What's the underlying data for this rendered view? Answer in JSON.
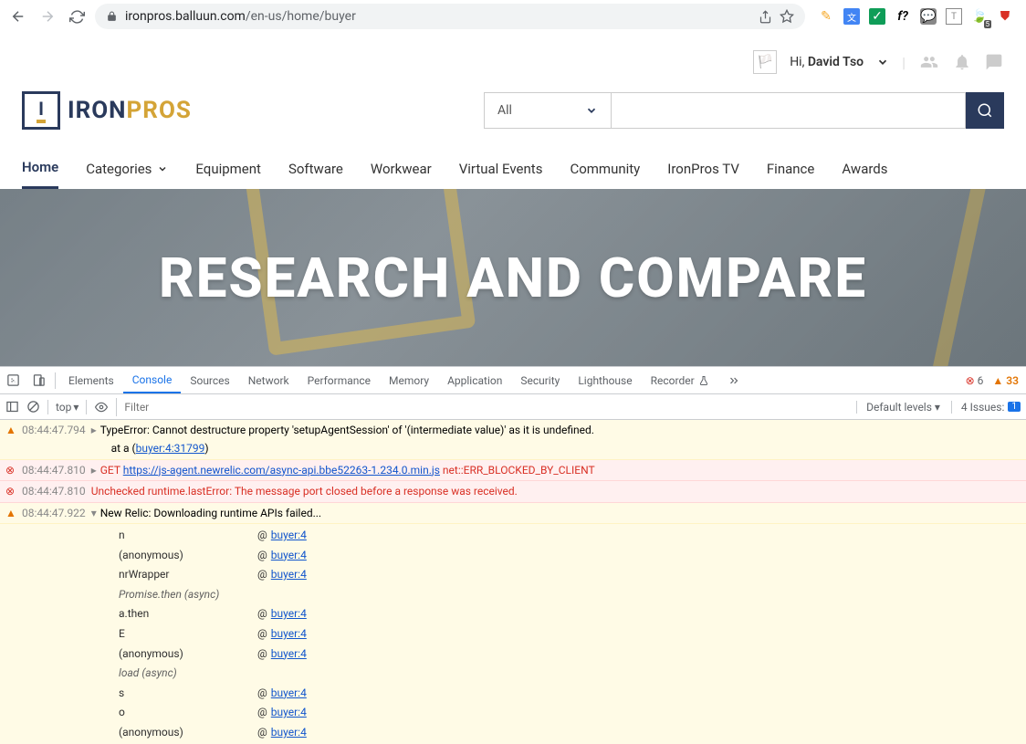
{
  "browser": {
    "url_domain": "ironpros.balluun.com",
    "url_path": "/en-us/home/buyer"
  },
  "header": {
    "greeting_prefix": "Hi, ",
    "greeting_name": "David Tso",
    "logo_iron": "IRON",
    "logo_pros": "PROS",
    "logo_mark": "I",
    "search_category": "All",
    "nav": {
      "home": "Home",
      "categories": "Categories",
      "equipment": "Equipment",
      "software": "Software",
      "workwear": "Workwear",
      "virtual": "Virtual Events",
      "community": "Community",
      "tv": "IronPros TV",
      "finance": "Finance",
      "awards": "Awards"
    }
  },
  "hero": {
    "title": "RESEARCH AND COMPARE"
  },
  "devtools": {
    "tabs": {
      "elements": "Elements",
      "console": "Console",
      "sources": "Sources",
      "network": "Network",
      "performance": "Performance",
      "memory": "Memory",
      "application": "Application",
      "security": "Security",
      "lighthouse": "Lighthouse",
      "recorder": "Recorder"
    },
    "err_count": "6",
    "warn_count": "33",
    "toolbar": {
      "context": "top",
      "filter_placeholder": "Filter",
      "levels": "Default levels",
      "issues_label": "4 Issues:",
      "issues_count": "1"
    },
    "logs": {
      "l1_time": "08:44:47.794",
      "l1_msg": "TypeError: Cannot destructure property 'setupAgentSession' of '(intermediate value)' as it is undefined.",
      "l1_sub": "    at a (",
      "l1_link": "buyer:4:31799",
      "l2_time": "08:44:47.810",
      "l2_method": "GET",
      "l2_url": "https://js-agent.newrelic.com/async-api.bbe52263-1.234.0.min.js",
      "l2_err": "net::ERR_BLOCKED_BY_CLIENT",
      "l3_time": "08:44:47.810",
      "l3_msg": "Unchecked runtime.lastError: The message port closed before a response was received.",
      "l4_time": "08:44:47.922",
      "l4_msg": "New Relic: Downloading runtime APIs failed...",
      "link": "buyer:4",
      "at": "@",
      "stack": {
        "s1": "n",
        "s2": "(anonymous)",
        "s3": "nrWrapper",
        "s4": "Promise.then (async)",
        "s5": "a.then",
        "s6": "E",
        "s7": "(anonymous)",
        "s8": "load (async)",
        "s9": "s",
        "s10": "o",
        "s11": "(anonymous)"
      }
    }
  }
}
